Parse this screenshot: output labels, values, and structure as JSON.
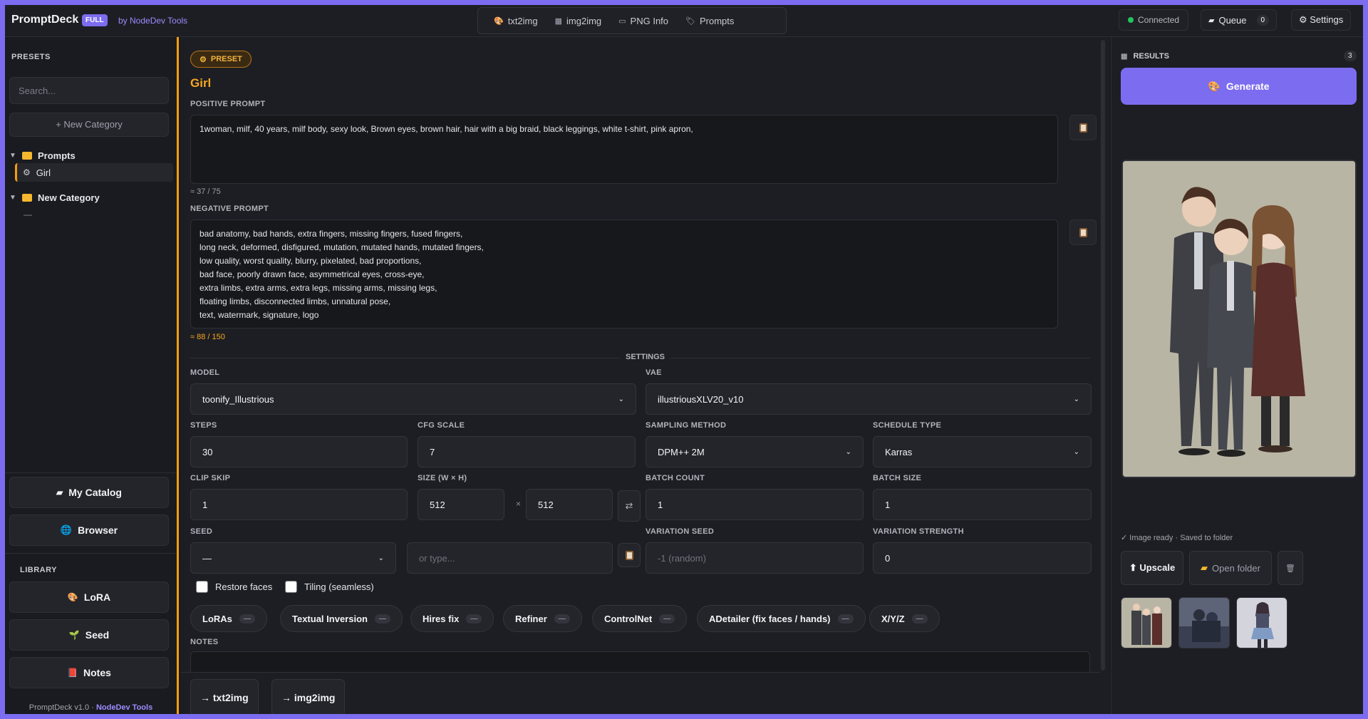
{
  "header": {
    "brand": "PromptDeck",
    "badge": "FULL",
    "by": "by NodeDev Tools",
    "tabs": [
      {
        "label": "txt2img",
        "icon": "palette-icon"
      },
      {
        "label": "img2img",
        "icon": "image-icon"
      },
      {
        "label": "PNG Info",
        "icon": "card-icon"
      },
      {
        "label": "Prompts",
        "icon": "tag-icon"
      }
    ],
    "connection": "Connected",
    "queue_label": "Queue",
    "queue_count": "0",
    "settings_label": "⚙ Settings"
  },
  "sidebar": {
    "title": "PRESETS",
    "search_placeholder": "Search...",
    "new_category": "+ New Category",
    "categories": [
      {
        "label": "Prompts",
        "items": [
          "Girl"
        ]
      },
      {
        "label": "New Category",
        "empty": "—"
      }
    ],
    "buttons": [
      {
        "label": "My Catalog",
        "icon": "folder-icon"
      },
      {
        "label": "Browser",
        "icon": "globe-icon"
      }
    ],
    "library_title": "LIBRARY",
    "library": [
      {
        "label": "LoRA",
        "icon": "palette-icon"
      },
      {
        "label": "Seed",
        "icon": "sprout-icon"
      },
      {
        "label": "Notes",
        "icon": "notebook-icon"
      }
    ],
    "footer_text": "PromptDeck v1.0 · ",
    "footer_link": "NodeDev Tools"
  },
  "main": {
    "preset_badge": "PRESET",
    "preset_name": "Girl",
    "positive_label": "POSITIVE PROMPT",
    "positive_text": "1woman, milf, 40 years, milf body, sexy look, Brown eyes, brown hair, hair with a big braid, black leggings, white t-shirt, pink apron,",
    "positive_count": "≈ 37 / 75",
    "negative_label": "NEGATIVE PROMPT",
    "negative_text": "bad anatomy, bad hands, extra fingers, missing fingers, fused fingers,\nlong neck, deformed, disfigured, mutation, mutated hands, mutated fingers,\nlow quality, worst quality, blurry, pixelated, bad proportions,\nbad face, poorly drawn face, asymmetrical eyes, cross-eye,\nextra limbs, extra arms, extra legs, missing arms, missing legs,\nfloating limbs, disconnected limbs, unnatural pose,\ntext, watermark, signature, logo",
    "negative_count": "≈ 88 / 150",
    "settings_title": "SETTINGS",
    "model_label": "MODEL",
    "model": "toonify_Illustrious",
    "vae_label": "VAE",
    "vae": "illustriousXLV20_v10",
    "steps_label": "STEPS",
    "steps": "30",
    "cfg_label": "CFG SCALE",
    "cfg": "7",
    "sampler_label": "SAMPLING METHOD",
    "sampler": "DPM++ 2M",
    "schedule_label": "SCHEDULE TYPE",
    "schedule": "Karras",
    "clip_label": "CLIP SKIP",
    "clip": "1",
    "size_label": "SIZE (W × H)",
    "width": "512",
    "height": "512",
    "times": "×",
    "batch_count_label": "BATCH COUNT",
    "batch_count": "1",
    "batch_size_label": "BATCH SIZE",
    "batch_size": "1",
    "seed_label": "SEED",
    "seed": "—",
    "seed_placeholder": "or type...",
    "var_seed_label": "VARIATION SEED",
    "var_seed_placeholder": "-1 (random)",
    "var_strength_label": "VARIATION STRENGTH",
    "var_strength": "0",
    "restore_faces": "Restore faces",
    "tiling": "Tiling (seamless)",
    "pills": [
      "LoRAs",
      "Textual Inversion",
      "Hires fix",
      "Refiner",
      "ControlNet",
      "ADetailer (fix faces / hands)",
      "X/Y/Z"
    ],
    "pill_state": "—",
    "notes_label": "NOTES",
    "send_txt2img": "→ txt2img",
    "send_img2img": "→ img2img"
  },
  "results": {
    "title": "RESULTS",
    "count": "3",
    "generate": "Generate",
    "status": "✓ Image ready · Saved to folder",
    "upscale": "⬆ Upscale",
    "open_folder": "Open folder"
  }
}
